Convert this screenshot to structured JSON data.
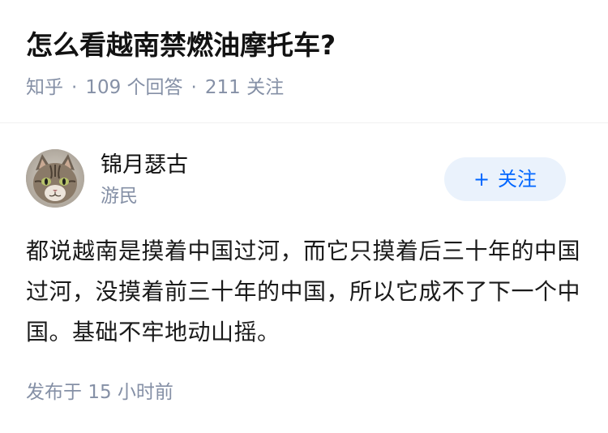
{
  "question": {
    "title": "怎么看越南禁燃油摩托车?",
    "source": "知乎",
    "answers_count": "109",
    "answers_label": "个回答",
    "followers_count": "211",
    "followers_label": "关注"
  },
  "author": {
    "name": "锦月瑟古",
    "tag": "游民",
    "avatar_icon": "cat-avatar-icon"
  },
  "follow_button": {
    "plus": "+",
    "label": "关注"
  },
  "answer": {
    "content": "都说越南是摸着中国过河，而它只摸着后三十年的中国过河，没摸着前三十年的中国，所以它成不了下一个中国。基础不牢地动山摇。",
    "time_prefix": "发布于",
    "time_value": "15 小时前"
  },
  "colors": {
    "title": "#121212",
    "meta": "#8590a6",
    "follow_bg": "#eaf2fc",
    "follow_text": "#0066ff"
  }
}
